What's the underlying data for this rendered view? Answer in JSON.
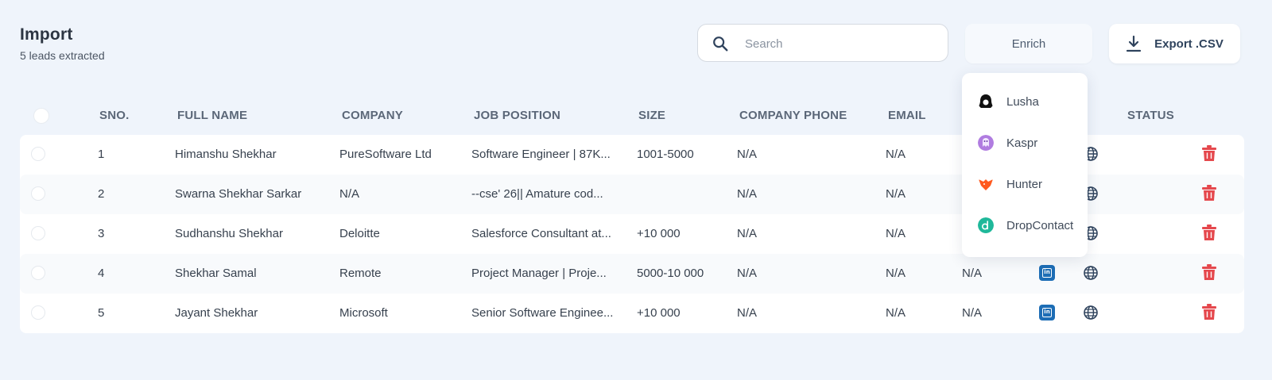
{
  "header": {
    "title": "Import",
    "subtitle": "5 leads extracted"
  },
  "search": {
    "placeholder": "Search",
    "value": ""
  },
  "toolbar": {
    "enrich_label": "Enrich",
    "export_label": "Export .CSV"
  },
  "enrich_menu": {
    "items": [
      {
        "label": "Lusha",
        "icon": "lusha-icon",
        "color": "#111111"
      },
      {
        "label": "Kaspr",
        "icon": "kaspr-icon",
        "color": "#b07ce0"
      },
      {
        "label": "Hunter",
        "icon": "hunter-icon",
        "color": "#ff5a1f"
      },
      {
        "label": "DropContact",
        "icon": "dropcontact-icon",
        "color": "#1fb89a"
      }
    ]
  },
  "table": {
    "columns": [
      "SNO.",
      "FULL NAME",
      "COMPANY",
      "JOB POSITION",
      "SIZE",
      "COMPANY PHONE",
      "EMAIL",
      "STATUS"
    ],
    "rows": [
      {
        "sno": "1",
        "name": "Himanshu Shekhar",
        "company": "PureSoftware Ltd",
        "position": "Software Engineer | 87K...",
        "size": "1001-5000",
        "phone": "N/A",
        "email": "N/A",
        "extra": ""
      },
      {
        "sno": "2",
        "name": "Swarna Shekhar Sarkar",
        "company": "N/A",
        "position": "--cse' 26|| Amature cod...",
        "size": "",
        "phone": "N/A",
        "email": "N/A",
        "extra": ""
      },
      {
        "sno": "3",
        "name": "Sudhanshu Shekhar",
        "company": "Deloitte",
        "position": "Salesforce Consultant at...",
        "size": "+10 000",
        "phone": "N/A",
        "email": "N/A",
        "extra": ""
      },
      {
        "sno": "4",
        "name": "Shekhar Samal",
        "company": "Remote",
        "position": "Project Manager | Proje...",
        "size": "5000-10 000",
        "phone": "N/A",
        "email": "N/A",
        "extra": "N/A"
      },
      {
        "sno": "5",
        "name": "Jayant Shekhar",
        "company": "Microsoft",
        "position": "Senior Software Enginee...",
        "size": "+10 000",
        "phone": "N/A",
        "email": "N/A",
        "extra": "N/A"
      }
    ]
  },
  "colors": {
    "accent": "#1d6db5",
    "delete": "#e5484d",
    "background": "#eff4fb"
  }
}
